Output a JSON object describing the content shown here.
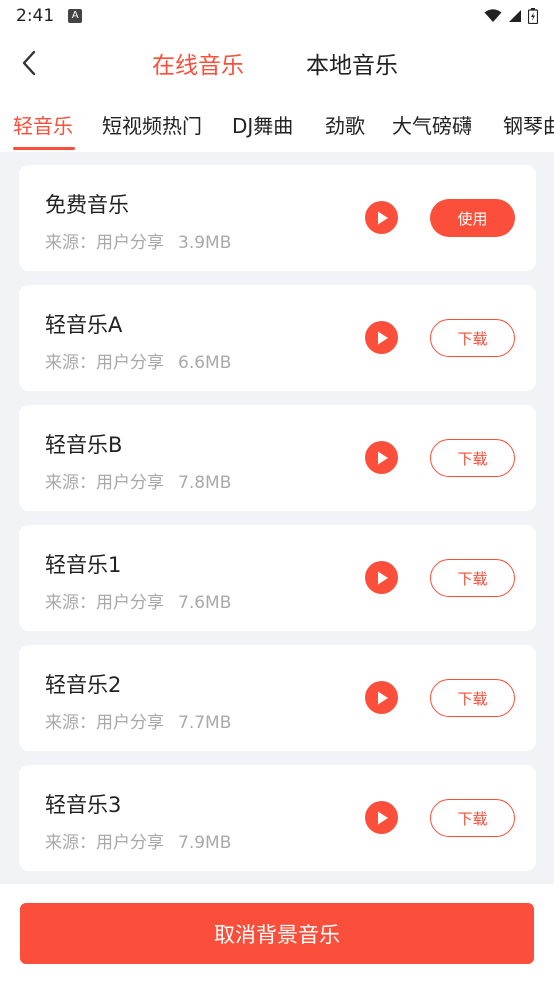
{
  "status_bar": {
    "time": "2:41",
    "notification_icon": "A",
    "icons": [
      "wifi-icon",
      "signal-icon",
      "battery-icon"
    ]
  },
  "header": {
    "back_icon": "chevron-left-icon",
    "tabs": [
      {
        "label": "在线音乐",
        "active": true
      },
      {
        "label": "本地音乐",
        "active": false
      }
    ]
  },
  "categories": [
    {
      "label": "轻音乐",
      "active": true
    },
    {
      "label": "短视频热门",
      "active": false
    },
    {
      "label": "DJ舞曲",
      "active": false
    },
    {
      "label": "劲歌",
      "active": false
    },
    {
      "label": "大气磅礴",
      "active": false
    },
    {
      "label": "钢琴曲",
      "active": false
    }
  ],
  "music_list": [
    {
      "title": "免费音乐",
      "source": "来源：用户分享",
      "size": "3.9MB",
      "action": "使用"
    },
    {
      "title": "轻音乐A",
      "source": "来源：用户分享",
      "size": "6.6MB",
      "action": "下载"
    },
    {
      "title": "轻音乐B",
      "source": "来源：用户分享",
      "size": "7.8MB",
      "action": "下载"
    },
    {
      "title": "轻音乐1",
      "source": "来源：用户分享",
      "size": "7.6MB",
      "action": "下载"
    },
    {
      "title": "轻音乐2",
      "source": "来源：用户分享",
      "size": "7.7MB",
      "action": "下载"
    },
    {
      "title": "轻音乐3",
      "source": "来源：用户分享",
      "size": "7.9MB",
      "action": "下载"
    }
  ],
  "bottom": {
    "cancel_label": "取消背景音乐"
  },
  "colors": {
    "accent": "#fb4f3b",
    "background": "#f2f3f7",
    "card": "#ffffff",
    "meta_text": "#a9a9a9"
  }
}
